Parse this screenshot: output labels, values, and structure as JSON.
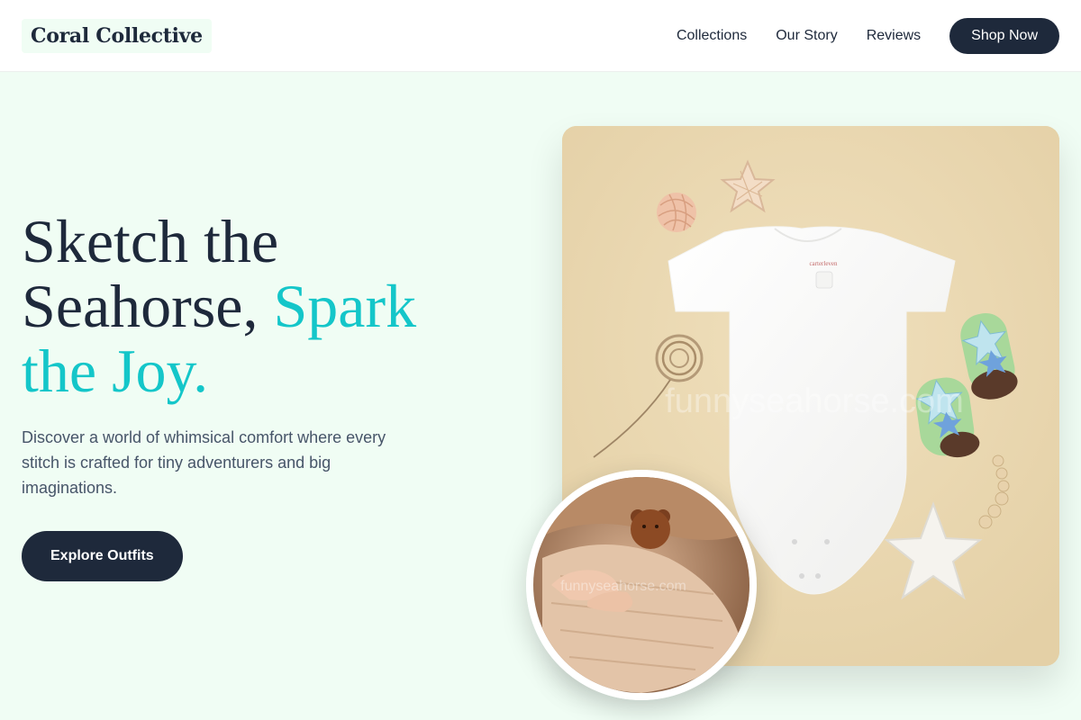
{
  "brand": {
    "name": "Coral Collective"
  },
  "nav": {
    "links": [
      "Collections",
      "Our Story",
      "Reviews"
    ],
    "cta_label": "Shop Now"
  },
  "hero": {
    "headline_part1": "Sketch the Seahorse, ",
    "headline_accent": "Spark the Joy.",
    "subtext": "Discover a world of whimsical comfort where every stitch is crafted for tiny adventurers and big imaginations.",
    "cta_label": "Explore Outfits"
  },
  "images": {
    "product_watermark": "funnyseahorse.com",
    "lifestyle_watermark": "funnyseahorse.com",
    "onesie_label": "carterleven"
  },
  "colors": {
    "page_bg": "#f0fdf4",
    "primary_dark": "#1e293b",
    "accent_teal": "#14c6c9",
    "body_text": "#475569",
    "product_bg": "#ead8b1"
  }
}
